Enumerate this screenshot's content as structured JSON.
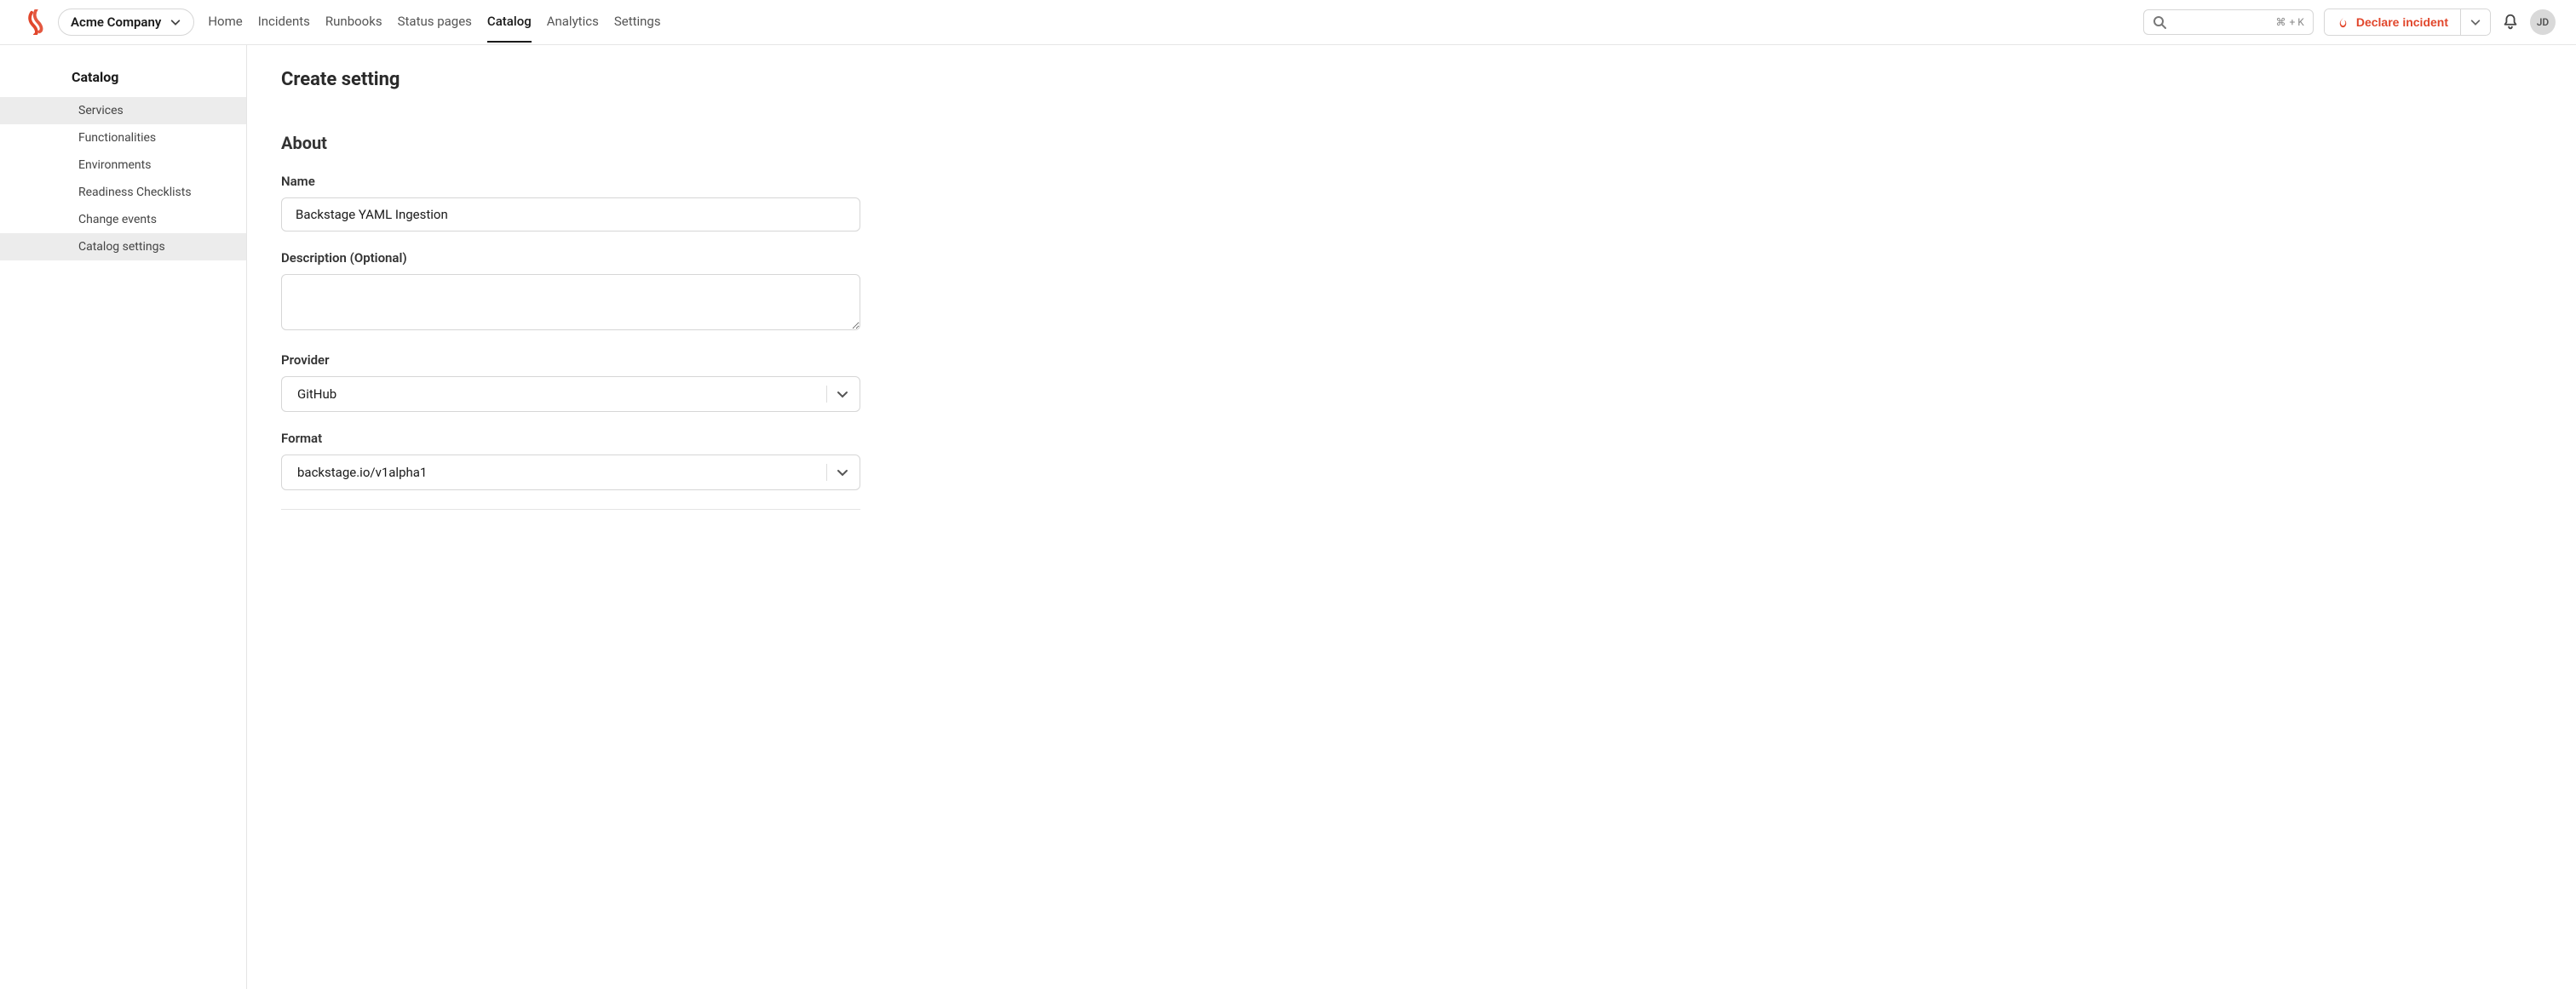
{
  "header": {
    "company": "Acme Company",
    "nav": [
      {
        "label": "Home",
        "active": false
      },
      {
        "label": "Incidents",
        "active": false
      },
      {
        "label": "Runbooks",
        "active": false
      },
      {
        "label": "Status pages",
        "active": false
      },
      {
        "label": "Catalog",
        "active": true
      },
      {
        "label": "Analytics",
        "active": false
      },
      {
        "label": "Settings",
        "active": false
      }
    ],
    "search_shortcut_sym": "⌘",
    "search_shortcut_rest": "+ K",
    "declare_label": "Declare incident",
    "avatar_initials": "JD"
  },
  "sidebar": {
    "title": "Catalog",
    "items": [
      {
        "label": "Services",
        "selected": true
      },
      {
        "label": "Functionalities",
        "selected": false
      },
      {
        "label": "Environments",
        "selected": false
      },
      {
        "label": "Readiness Checklists",
        "selected": false
      },
      {
        "label": "Change events",
        "selected": false
      },
      {
        "label": "Catalog settings",
        "selected": true
      }
    ]
  },
  "main": {
    "page_title": "Create setting",
    "section_title": "About",
    "fields": {
      "name": {
        "label": "Name",
        "value": "Backstage YAML Ingestion"
      },
      "description": {
        "label": "Description (Optional)",
        "value": ""
      },
      "provider": {
        "label": "Provider",
        "value": "GitHub"
      },
      "format": {
        "label": "Format",
        "value": "backstage.io/v1alpha1"
      }
    }
  }
}
